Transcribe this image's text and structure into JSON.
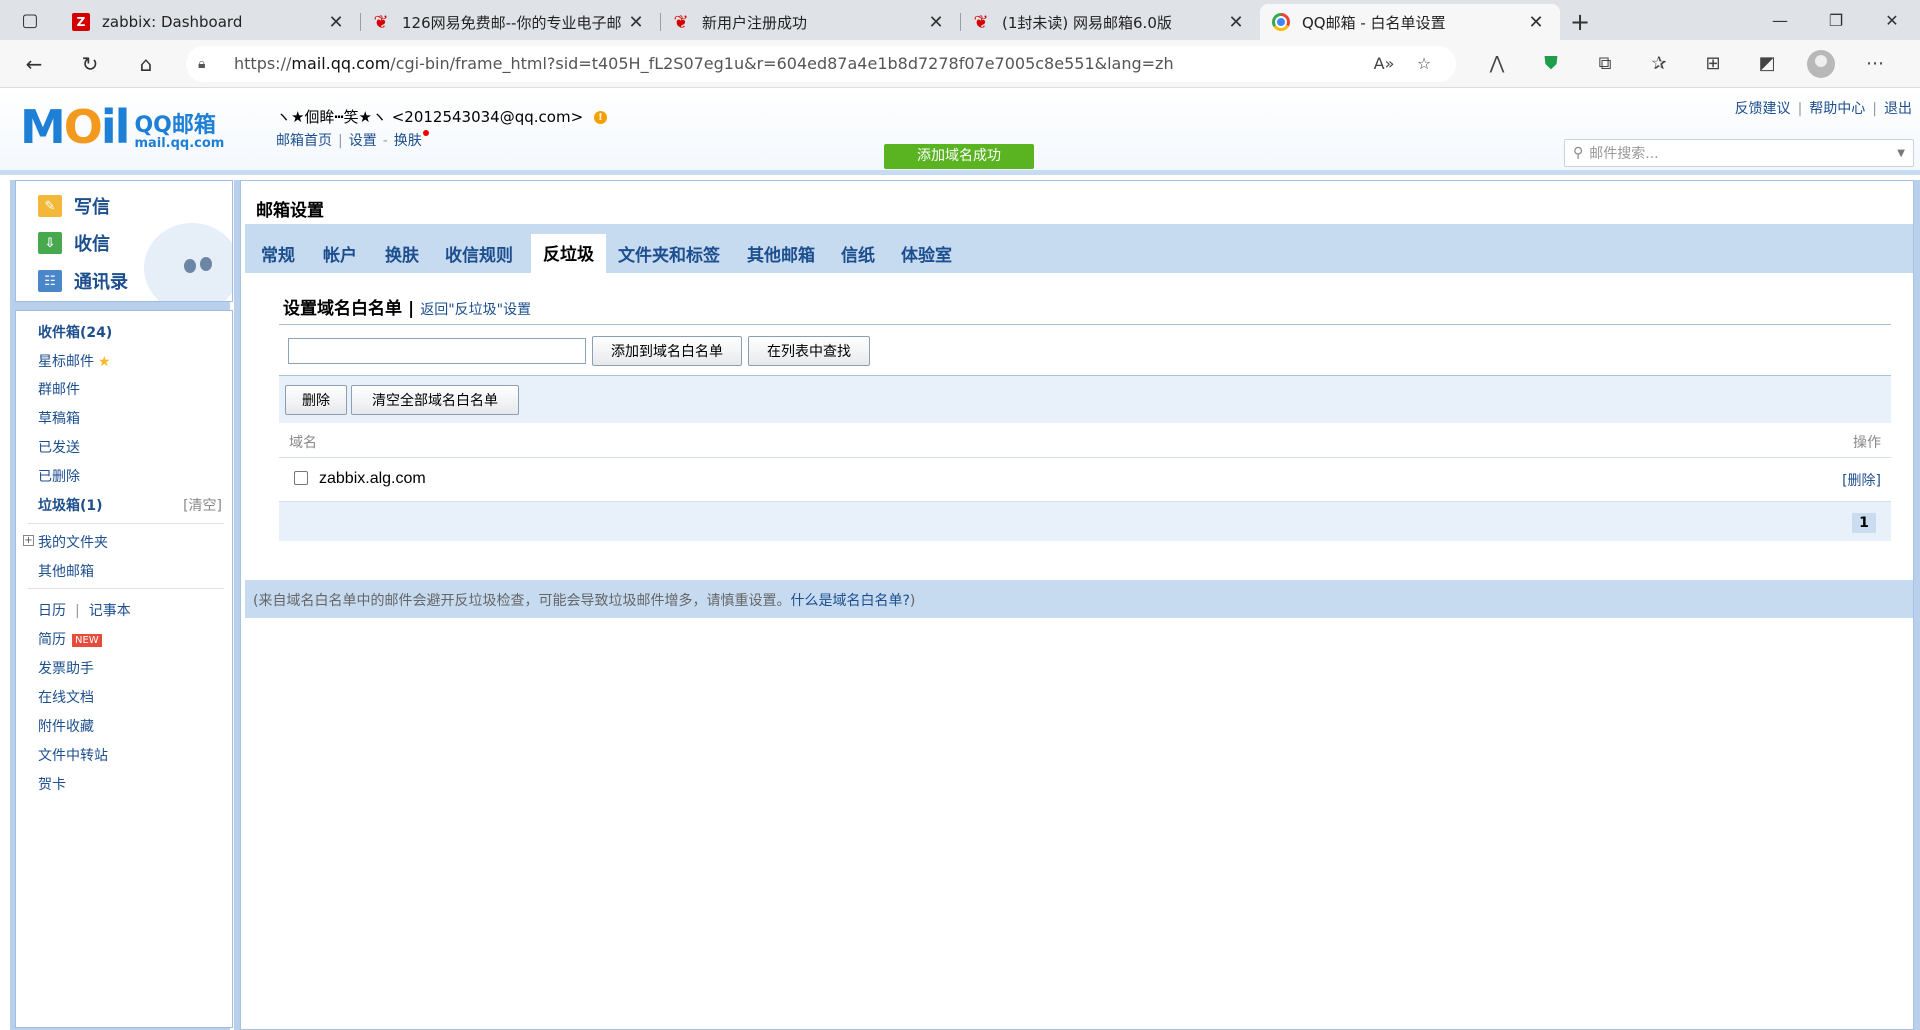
{
  "browser": {
    "tabs": [
      {
        "title": "zabbix: Dashboard",
        "icon": "zabbix-icon",
        "active": false
      },
      {
        "title": "126网易免费邮--你的专业电子邮",
        "icon": "netease-icon",
        "active": false
      },
      {
        "title": "新用户注册成功",
        "icon": "netease-icon",
        "active": false
      },
      {
        "title": "(1封未读) 网易邮箱6.0版",
        "icon": "netease-icon",
        "active": false
      },
      {
        "title": "QQ邮箱 - 白名单设置",
        "icon": "qq-mail-icon",
        "active": true
      }
    ],
    "url_prefix": "https://",
    "url_host": "mail.qq.com",
    "url_rest": "/cgi-bin/frame_html?sid=t405H_fL2S07eg1u&r=604ed87a4e1b8d7278f07e7005c8e551&lang=zh"
  },
  "header": {
    "logo_cn": "QQ邮箱",
    "logo_domain": "mail.qq.com",
    "user_nick": "ヽ★佪眸┅笑★ヽ",
    "user_email": "<2012543034@qq.com>",
    "links": {
      "home": "邮箱首页",
      "settings": "设置",
      "skin": "换肤"
    },
    "top_links": {
      "feedback": "反馈建议",
      "help": "帮助中心",
      "logout": "退出"
    },
    "search_placeholder": "邮件搜索...",
    "toast": "添加域名成功"
  },
  "sidebar": {
    "quick": {
      "write": "写信",
      "receive": "收信",
      "contacts": "通讯录"
    },
    "folders": {
      "inbox": "收件箱(24)",
      "starred": "星标邮件",
      "group": "群邮件",
      "drafts": "草稿箱",
      "sent": "已发送",
      "deleted": "已删除",
      "spam": "垃圾箱(1)",
      "spam_clear": "[清空]",
      "my_folders": "我的文件夹",
      "other_mail": "其他邮箱",
      "calendar": "日历",
      "notes": "记事本",
      "resume": "简历",
      "new_badge": "NEW",
      "invoice": "发票助手",
      "docs": "在线文档",
      "attachments": "附件收藏",
      "transfer": "文件中转站",
      "cards": "贺卡"
    }
  },
  "settings": {
    "title": "邮箱设置",
    "tabs": [
      "常规",
      "帐户",
      "换肤",
      "收信规则",
      "反垃圾",
      "文件夹和标签",
      "其他邮箱",
      "信纸",
      "体验室"
    ],
    "active_tab": "反垃圾",
    "section_title": "设置域名白名单",
    "back_link": "返回\"反垃圾\"设置",
    "input_value": "",
    "add_button": "添加到域名白名单",
    "find_button": "在列表中查找",
    "delete_button": "删除",
    "clear_button": "清空全部域名白名单",
    "col_domain": "域名",
    "col_op": "操作",
    "rows": [
      {
        "domain": "zabbix.alg.com",
        "action": "[删除]"
      }
    ],
    "page": "1",
    "hint_text": "(来自域名白名单中的邮件会避开反垃圾检查，可能会导致垃圾邮件增多，请慎重设置。",
    "hint_link": "什么是域名白名单?",
    "hint_end": ")"
  }
}
